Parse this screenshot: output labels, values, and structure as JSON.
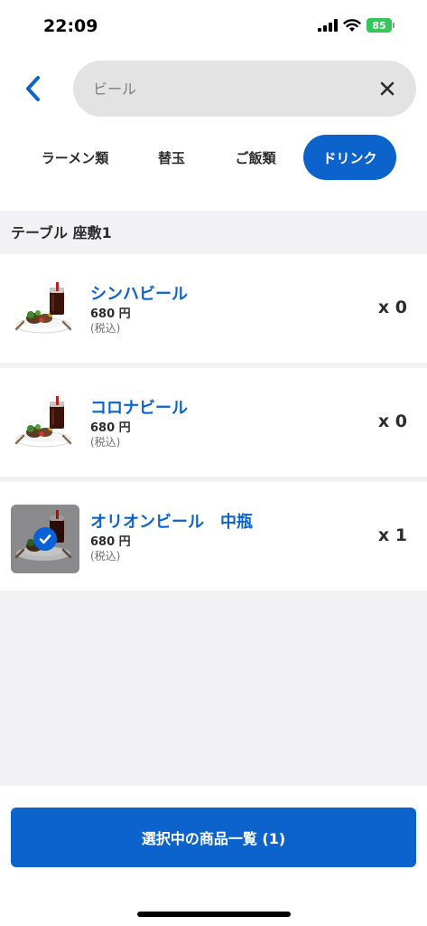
{
  "status_bar": {
    "time": "22:09",
    "battery": "85"
  },
  "search": {
    "placeholder": "ビール",
    "value": ""
  },
  "tabs": [
    {
      "label": "ラーメン類",
      "active": false
    },
    {
      "label": "替玉",
      "active": false
    },
    {
      "label": "ご飯類",
      "active": false
    },
    {
      "label": "ドリンク",
      "active": true
    }
  ],
  "section": {
    "title": "テーブル 座敷1"
  },
  "items": [
    {
      "name": "シンハビール",
      "price": "680 円",
      "tax": "(税込)",
      "qty": "x 0",
      "selected": false,
      "icon": "food-drink-image"
    },
    {
      "name": "コロナビール",
      "price": "680 円",
      "tax": "(税込)",
      "qty": "x 0",
      "selected": false,
      "icon": "food-drink-image"
    },
    {
      "name": "オリオンビール　中瓶",
      "price": "680 円",
      "tax": "(税込)",
      "qty": "x 1",
      "selected": true,
      "icon": "food-drink-image"
    }
  ],
  "footer": {
    "label": "選択中の商品一覧 (1)"
  },
  "colors": {
    "accent": "#0c63cc",
    "search_bg": "#e3e3e4",
    "list_bg": "#f2f2f4",
    "battery": "#34c759"
  }
}
